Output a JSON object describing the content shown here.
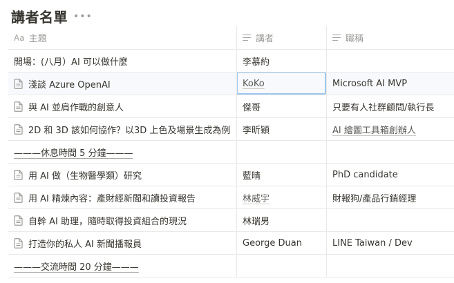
{
  "title": "講者名單",
  "more_icon": "more-horizontal-icon",
  "columns": [
    {
      "label": "主題",
      "icon": "Aa"
    },
    {
      "label": "講者",
      "icon": "text-lines-icon"
    },
    {
      "label": "職稱",
      "icon": "text-lines-icon"
    }
  ],
  "rows": [
    {
      "topic": "開場：(八月）AI 可以做什麼",
      "speaker": "李慕約",
      "role": "",
      "doc_icon": false,
      "break": false,
      "selected": false,
      "speaker_underline": false,
      "role_underline": false
    },
    {
      "topic": "淺談 Azure OpenAI",
      "speaker": "KoKo",
      "role": "Microsoft AI MVP",
      "doc_icon": true,
      "break": false,
      "selected": true,
      "speaker_underline": true,
      "role_underline": false
    },
    {
      "topic": "與 AI 並肩作戰的創意人",
      "speaker": "傑哥",
      "role": "只要有人社群顧問/執行長",
      "doc_icon": true,
      "break": false,
      "selected": false,
      "speaker_underline": false,
      "role_underline": false
    },
    {
      "topic": "2D 和 3D 該如何協作？以3D 上色及場景生成為例",
      "speaker": "李昕穎",
      "role": "AI 繪圖工具箱創辦人",
      "doc_icon": true,
      "break": false,
      "selected": false,
      "speaker_underline": false,
      "role_underline": true
    },
    {
      "topic": "———休息時間 5 分鐘———",
      "speaker": "",
      "role": "",
      "doc_icon": false,
      "break": true,
      "selected": false,
      "speaker_underline": false,
      "role_underline": false
    },
    {
      "topic": "用 AI 做（生物醫學類）研究",
      "speaker": "藍晴",
      "role": "PhD candidate",
      "doc_icon": true,
      "break": false,
      "selected": false,
      "speaker_underline": false,
      "role_underline": false
    },
    {
      "topic": "用 AI 精煉內容：產財經新聞和讀投資報告",
      "speaker": "林威宇",
      "role": "財報狗/產品行銷經理",
      "doc_icon": true,
      "break": false,
      "selected": false,
      "speaker_underline": true,
      "role_underline": false
    },
    {
      "topic": "自幹 AI 助理，隨時取得投資組合的現況",
      "speaker": "林瑞男",
      "role": "",
      "doc_icon": true,
      "break": false,
      "selected": false,
      "speaker_underline": false,
      "role_underline": false
    },
    {
      "topic": "打造你的私人 AI 新聞播報員",
      "speaker": "George Duan",
      "role": "LINE Taiwan / Dev",
      "doc_icon": true,
      "break": false,
      "selected": false,
      "speaker_underline": false,
      "role_underline": false
    },
    {
      "topic": "———交流時間 20 分鐘———",
      "speaker": "",
      "role": "",
      "doc_icon": false,
      "break": true,
      "selected": false,
      "speaker_underline": false,
      "role_underline": false
    }
  ]
}
